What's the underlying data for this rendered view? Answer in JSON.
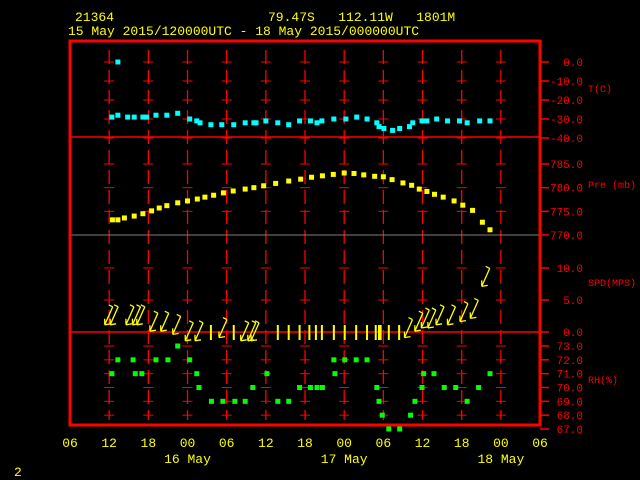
{
  "header": {
    "station": "21364",
    "location": "79.47S   112.11W   1801M",
    "period": "15 May 2015/120000UTC - 18 May 2015/000000UTC"
  },
  "page_number": "2",
  "colors": {
    "frame": "#ff0000",
    "temperature": "#00ffff",
    "pressure": "#ffff00",
    "wind": "#ffff00",
    "rh": "#00ff00",
    "text": "#ffff00"
  },
  "chart_data": [
    {
      "type": "scatter",
      "ylabel": "T(C)",
      "yticks": [
        "0.0",
        "-10.0",
        "-20.0",
        "-30.0",
        "-40.0"
      ],
      "ylim": [
        -40,
        0
      ],
      "points": [
        [
          "15 13:20",
          0.0
        ],
        [
          "15 12:25",
          -29
        ],
        [
          "15 13:20",
          -28
        ],
        [
          "15 14:50",
          -29
        ],
        [
          "15 15:50",
          -29
        ],
        [
          "15 17:10",
          -29
        ],
        [
          "15 17:45",
          -29
        ],
        [
          "15 19:10",
          -28
        ],
        [
          "15 20:50",
          -28
        ],
        [
          "15 22:30",
          -27
        ],
        [
          "16 00:20",
          -30
        ],
        [
          "16 01:25",
          -31
        ],
        [
          "16 01:55",
          -32
        ],
        [
          "16 03:35",
          -33
        ],
        [
          "16 05:15",
          -33
        ],
        [
          "16 07:05",
          -33
        ],
        [
          "16 08:50",
          -32
        ],
        [
          "16 10:10",
          -32
        ],
        [
          "16 10:30",
          -32
        ],
        [
          "16 12:00",
          -31
        ],
        [
          "16 13:50",
          -32
        ],
        [
          "16 15:30",
          -33
        ],
        [
          "16 17:10",
          -31
        ],
        [
          "16 18:50",
          -31
        ],
        [
          "16 19:50",
          -32
        ],
        [
          "16 20:35",
          -31
        ],
        [
          "16 22:25",
          -30
        ],
        [
          "17 00:15",
          -30
        ],
        [
          "17 01:55",
          -29
        ],
        [
          "17 03:30",
          -30
        ],
        [
          "17 05:00",
          -32
        ],
        [
          "17 05:20",
          -34
        ],
        [
          "17 06:05",
          -35
        ],
        [
          "17 07:25",
          -36
        ],
        [
          "17 08:30",
          -35
        ],
        [
          "17 10:00",
          -34
        ],
        [
          "17 10:30",
          -32
        ],
        [
          "17 11:55",
          -31
        ],
        [
          "17 12:40",
          -31
        ],
        [
          "17 14:10",
          -30
        ],
        [
          "17 15:50",
          -31
        ],
        [
          "17 17:40",
          -31
        ],
        [
          "17 18:50",
          -32
        ],
        [
          "17 20:45",
          -31
        ],
        [
          "17 22:20",
          -31
        ]
      ]
    },
    {
      "type": "scatter",
      "ylabel": "Pre (mb)",
      "yticks": [
        "785.0",
        "780.0",
        "775.0",
        "770.0"
      ],
      "ylim": [
        770,
        785
      ],
      "points": [
        [
          "15 12:30",
          773.2
        ],
        [
          "15 13:20",
          773.2
        ],
        [
          "15 14:20",
          773.6
        ],
        [
          "15 15:50",
          774.0
        ],
        [
          "15 17:10",
          774.5
        ],
        [
          "15 18:30",
          775.1
        ],
        [
          "15 19:40",
          775.7
        ],
        [
          "15 20:50",
          776.2
        ],
        [
          "15 22:30",
          776.8
        ],
        [
          "16 00:00",
          777.2
        ],
        [
          "16 01:30",
          777.6
        ],
        [
          "16 02:40",
          778.0
        ],
        [
          "16 04:00",
          778.4
        ],
        [
          "16 05:30",
          778.9
        ],
        [
          "16 07:00",
          779.3
        ],
        [
          "16 08:50",
          779.7
        ],
        [
          "16 10:10",
          780.0
        ],
        [
          "16 11:40",
          780.4
        ],
        [
          "16 13:30",
          780.9
        ],
        [
          "16 15:30",
          781.4
        ],
        [
          "16 17:20",
          781.8
        ],
        [
          "16 19:00",
          782.2
        ],
        [
          "16 20:40",
          782.5
        ],
        [
          "16 22:20",
          782.8
        ],
        [
          "17 00:00",
          783.1
        ],
        [
          "17 01:30",
          783.0
        ],
        [
          "17 03:00",
          782.7
        ],
        [
          "17 04:40",
          782.4
        ],
        [
          "17 06:00",
          782.3
        ],
        [
          "17 07:20",
          781.7
        ],
        [
          "17 09:00",
          781.0
        ],
        [
          "17 10:20",
          780.5
        ],
        [
          "17 11:30",
          779.7
        ],
        [
          "17 12:40",
          779.2
        ],
        [
          "17 13:50",
          778.6
        ],
        [
          "17 15:10",
          778.0
        ],
        [
          "17 16:50",
          777.2
        ],
        [
          "17 18:10",
          776.3
        ],
        [
          "17 19:40",
          775.2
        ],
        [
          "17 21:10",
          772.7
        ],
        [
          "17 22:20",
          771.1
        ]
      ]
    },
    {
      "type": "scatter",
      "ylabel": "SPD(MPS)",
      "yticks": [
        "10.0",
        "5.0",
        "0.0"
      ],
      "ylim": [
        0,
        10
      ],
      "wind_direction_deg": 45,
      "points": [
        [
          "15 12:05",
          3
        ],
        [
          "15 12:55",
          3
        ],
        [
          "15 15:20",
          3
        ],
        [
          "15 16:20",
          3
        ],
        [
          "15 17:00",
          3
        ],
        [
          "15 19:00",
          2
        ],
        [
          "15 20:40",
          2
        ],
        [
          "15 22:30",
          1.5
        ],
        [
          "16 00:25",
          0.5
        ],
        [
          "16 01:55",
          0.5
        ],
        [
          "16 05:35",
          1
        ],
        [
          "16 08:55",
          0.5
        ],
        [
          "16 10:00",
          0.5
        ],
        [
          "16 10:30",
          0.5
        ],
        [
          "17 10:00",
          1
        ],
        [
          "17 11:35",
          2
        ],
        [
          "17 12:35",
          2.5
        ],
        [
          "17 13:35",
          2.5
        ],
        [
          "17 14:50",
          3
        ],
        [
          "17 16:35",
          3
        ],
        [
          "17 18:30",
          3.5
        ],
        [
          "17 20:05",
          4
        ],
        [
          "17 21:50",
          9
        ]
      ],
      "calm": [
        "16 03:35",
        "16 07:05",
        "16 13:50",
        "16 15:30",
        "16 17:10",
        "16 18:40",
        "16 19:40",
        "16 20:35",
        "16 22:25",
        "17 00:05",
        "17 01:50",
        "17 03:30",
        "17 04:50",
        "17 05:20",
        "17 05:35",
        "17 06:50",
        "17 08:25"
      ]
    },
    {
      "type": "scatter",
      "ylabel": "RH(%)",
      "yticks": [
        "73.0",
        "72.0",
        "71.0",
        "70.0",
        "69.0",
        "68.0",
        "67.0"
      ],
      "ylim": [
        67,
        73
      ],
      "points": [
        [
          "15 22:30",
          73
        ],
        [
          "15 13:20",
          72
        ],
        [
          "15 15:40",
          72
        ],
        [
          "15 19:10",
          72
        ],
        [
          "15 21:00",
          72
        ],
        [
          "16 00:20",
          72
        ],
        [
          "16 22:25",
          72
        ],
        [
          "17 00:05",
          72
        ],
        [
          "17 01:50",
          72
        ],
        [
          "17 03:30",
          72
        ],
        [
          "15 12:25",
          71
        ],
        [
          "15 16:00",
          71
        ],
        [
          "15 17:00",
          71
        ],
        [
          "16 01:25",
          71
        ],
        [
          "16 12:10",
          71
        ],
        [
          "16 22:35",
          71
        ],
        [
          "17 12:10",
          71
        ],
        [
          "17 13:45",
          71
        ],
        [
          "17 22:20",
          71
        ],
        [
          "16 01:45",
          70
        ],
        [
          "16 10:00",
          70
        ],
        [
          "16 17:10",
          70
        ],
        [
          "16 18:50",
          70
        ],
        [
          "16 19:50",
          70
        ],
        [
          "16 20:40",
          70
        ],
        [
          "17 05:00",
          70
        ],
        [
          "17 11:55",
          70
        ],
        [
          "17 15:20",
          70
        ],
        [
          "17 17:05",
          70
        ],
        [
          "17 20:35",
          70
        ],
        [
          "16 03:40",
          69
        ],
        [
          "16 05:25",
          69
        ],
        [
          "16 07:15",
          69
        ],
        [
          "16 08:50",
          69
        ],
        [
          "16 13:50",
          69
        ],
        [
          "16 15:30",
          69
        ],
        [
          "17 05:20",
          69
        ],
        [
          "17 10:50",
          69
        ],
        [
          "17 18:50",
          69
        ],
        [
          "17 05:50",
          68
        ],
        [
          "17 10:10",
          68
        ],
        [
          "17 06:50",
          67
        ],
        [
          "17 08:30",
          67
        ]
      ]
    }
  ],
  "x_axis": {
    "tick_labels": [
      "06",
      "12",
      "18",
      "00",
      "06",
      "12",
      "18",
      "00",
      "06",
      "12",
      "18",
      "00",
      "06"
    ],
    "date_labels": [
      "16 May",
      "17 May",
      "18 May"
    ]
  }
}
